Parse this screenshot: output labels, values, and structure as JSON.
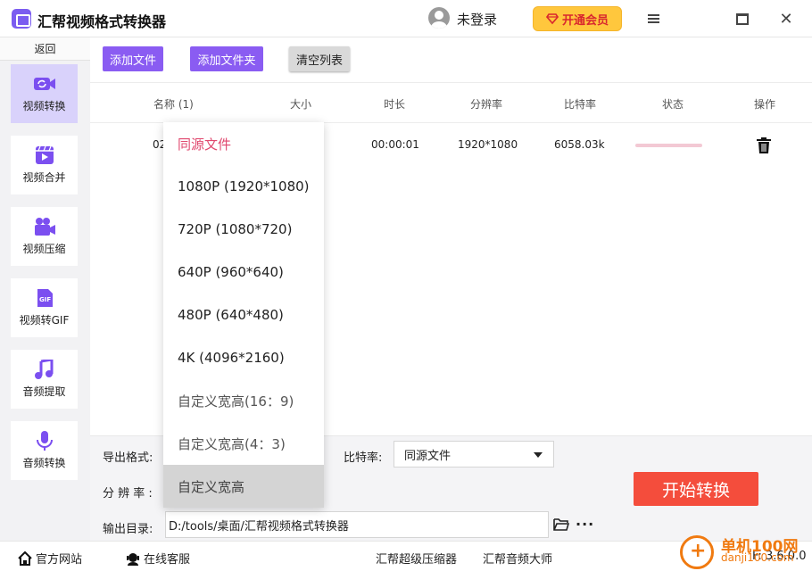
{
  "titlebar": {
    "app_title": "汇帮视频格式转换器",
    "login_label": "未登录",
    "vip_label": "开通会员"
  },
  "sidebar": {
    "back_label": "返回",
    "items": [
      {
        "label": "视频转换",
        "icon": "video-convert-icon",
        "active": true
      },
      {
        "label": "视频合并",
        "icon": "video-merge-icon",
        "active": false
      },
      {
        "label": "视频压缩",
        "icon": "video-compress-icon",
        "active": false
      },
      {
        "label": "视频转GIF",
        "icon": "gif-icon",
        "active": false
      },
      {
        "label": "音频提取",
        "icon": "music-note-icon",
        "active": false
      },
      {
        "label": "音频转换",
        "icon": "microphone-icon",
        "active": false
      }
    ]
  },
  "toolbar": {
    "add_file_label": "添加文件",
    "add_folder_label": "添加文件夹",
    "clear_list_label": "清空列表"
  },
  "table": {
    "columns": [
      "名称 (1)",
      "大小",
      "时长",
      "分辨率",
      "比特率",
      "状态",
      "操作"
    ],
    "rows": [
      {
        "name": "02",
        "size": "",
        "duration": "00:00:01",
        "resolution": "1920*1080",
        "bitrate": "6058.03k",
        "status_progress": 0
      }
    ]
  },
  "settings": {
    "format_label": "导出格式:",
    "bitrate_label": "比特率:",
    "bitrate_value": "同源文件",
    "resolution_label": "分 辨 率 :",
    "output_label": "输出目录:",
    "output_path": "D:/tools/桌面/汇帮视频格式转换器",
    "start_label": "开始转换"
  },
  "resolution_dropdown": {
    "selected": "同源文件",
    "hovered": "自定义宽高",
    "options": [
      "同源文件",
      "1080P (1920*1080)",
      "720P (1080*720)",
      "640P (960*640)",
      "480P (640*480)",
      "4K (4096*2160)",
      "自定义宽高(16：9)",
      "自定义宽高(4：3)",
      "自定义宽高"
    ]
  },
  "statusbar": {
    "website_label": "官方网站",
    "service_label": "在线客服",
    "compressor_label": "汇帮超级压缩器",
    "audio_master_label": "汇帮音频大师",
    "version_prefix": "F:",
    "version": "3.6.0.0"
  },
  "watermark": {
    "site_name": "单机100网",
    "site_url": "danji100.com"
  },
  "colors": {
    "accent_purple": "#8a5cf2",
    "start_red": "#f44d3c",
    "vip_yellow": "#ffc73d",
    "selected_pink": "#e0486e"
  }
}
